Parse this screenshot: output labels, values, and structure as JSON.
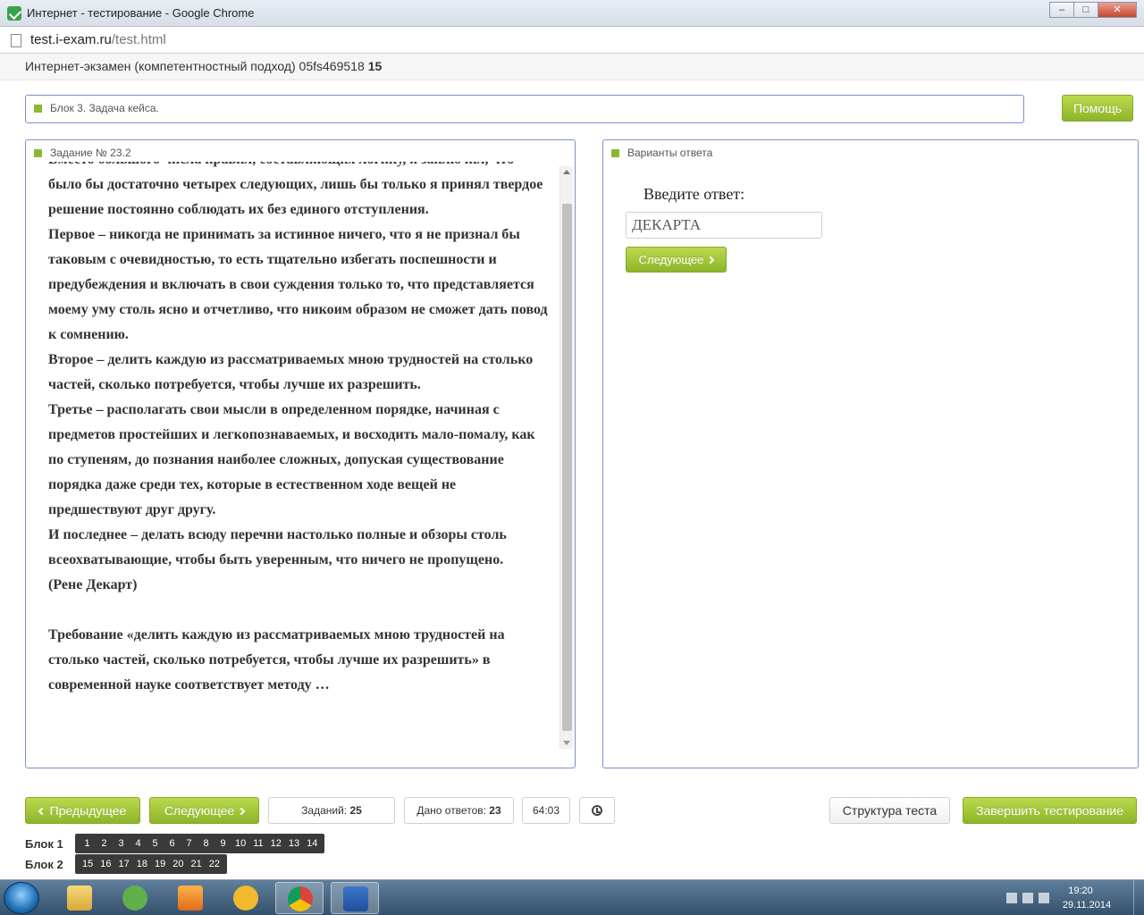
{
  "window": {
    "title": "Интернет - тестирование - Google Chrome",
    "min_label": "–",
    "max_label": "□",
    "close_label": "✕"
  },
  "address": {
    "host": "test.i-exam.ru",
    "path": "/test.html"
  },
  "exam": {
    "header_text": "Интернет-экзамен (компетентностный подход) 05fs469518",
    "header_number": "15"
  },
  "block": {
    "label": "Блок 3. Задача кейса."
  },
  "help_button": "Помощь",
  "task": {
    "title": "Задание № 23.2",
    "paragraphs": [
      "Вместо большого числа правил, составляющих логику, я заключил, что было бы достаточно четырех следующих, лишь бы только я принял твердое решение постоянно соблюдать их без единого отступления.",
      "Первое – никогда не принимать за истинное ничего, что я не признал бы таковым с очевидностью, то есть тщательно избегать поспешности и предубеждения и включать в свои суждения только то, что представляется моему уму столь ясно и отчетливо, что никоим образом не сможет дать повод к сомнению.",
      "Второе – делить каждую из рассматриваемых мною трудностей на столько частей, сколько потребуется, чтобы лучше их разрешить.",
      "Третье – располагать свои мысли в определенном порядке, начиная с предметов простейших и легкопознаваемых, и восходить мало-помалу, как по ступеням, до познания наиболее сложных, допуская существование порядка даже среди тех, которые в естественном ходе вещей не предшествуют друг другу.",
      "И последнее – делать всюду перечни настолько полные и обзоры столь всеохватывающие, чтобы быть уверенным, что ничего не пропущено.",
      "(Рене Декарт)"
    ],
    "question": "Требование «делить каждую из рассматриваемых мною трудностей на столько частей, сколько потребуется, чтобы лучше их разрешить» в современной науке соответствует методу …"
  },
  "answer": {
    "title": "Варианты ответа",
    "prompt": "Введите ответ:",
    "value": "ДЕКАРТА",
    "next_label": "Следующее"
  },
  "nav": {
    "prev_label": "Предыдущее",
    "next_label": "Следующее",
    "tasks_label": "Заданий:",
    "tasks_count": "25",
    "answers_label": "Дано ответов:",
    "answers_count": "23",
    "timer": "64:03",
    "structure_label": "Структура теста",
    "finish_label": "Завершить тестирование"
  },
  "blocks": [
    {
      "label": "Блок 1",
      "items": [
        "1",
        "2",
        "3",
        "4",
        "5",
        "6",
        "7",
        "8",
        "9",
        "10",
        "11",
        "12",
        "13",
        "14"
      ]
    },
    {
      "label": "Блок 2",
      "items": [
        "15",
        "16",
        "17",
        "18",
        "19",
        "20",
        "21",
        "22"
      ]
    }
  ],
  "taskbar": {
    "time": "19:20",
    "date": "29.11.2014"
  },
  "colors": {
    "accent_green": "#8db52a",
    "panel_border": "#7b8ec9"
  }
}
